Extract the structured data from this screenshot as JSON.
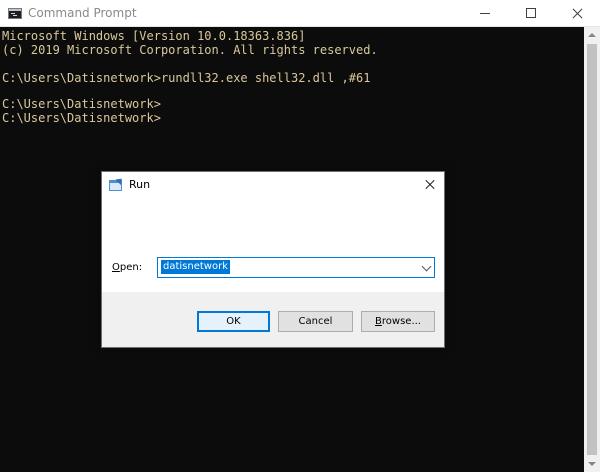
{
  "cmd_window": {
    "title": "Command Prompt",
    "icon": "cmd-icon",
    "caption_icons": [
      "minimize-icon",
      "maximize-icon",
      "close-icon"
    ],
    "console_lines": [
      "Microsoft Windows [Version 10.0.18363.836]",
      "(c) 2019 Microsoft Corporation. All rights reserved.",
      "",
      "C:\\Users\\Datisnetwork>rundll32.exe shell32.dll ,#61",
      "",
      "C:\\Users\\Datisnetwork>",
      "C:\\Users\\Datisnetwork>"
    ],
    "text_color": "#d9c89a",
    "background_color": "#0c0c0c"
  },
  "run_dialog": {
    "title": "Run",
    "icon": "run-icon",
    "close_icon": "close-icon",
    "open_label": {
      "mnemonic": "O",
      "rest": "pen:"
    },
    "open_value": "datisnetwork",
    "selection_color": "#0078d7",
    "buttons": {
      "ok": "OK",
      "cancel": "Cancel",
      "browse": {
        "mnemonic": "B",
        "rest": "rowse..."
      }
    }
  }
}
